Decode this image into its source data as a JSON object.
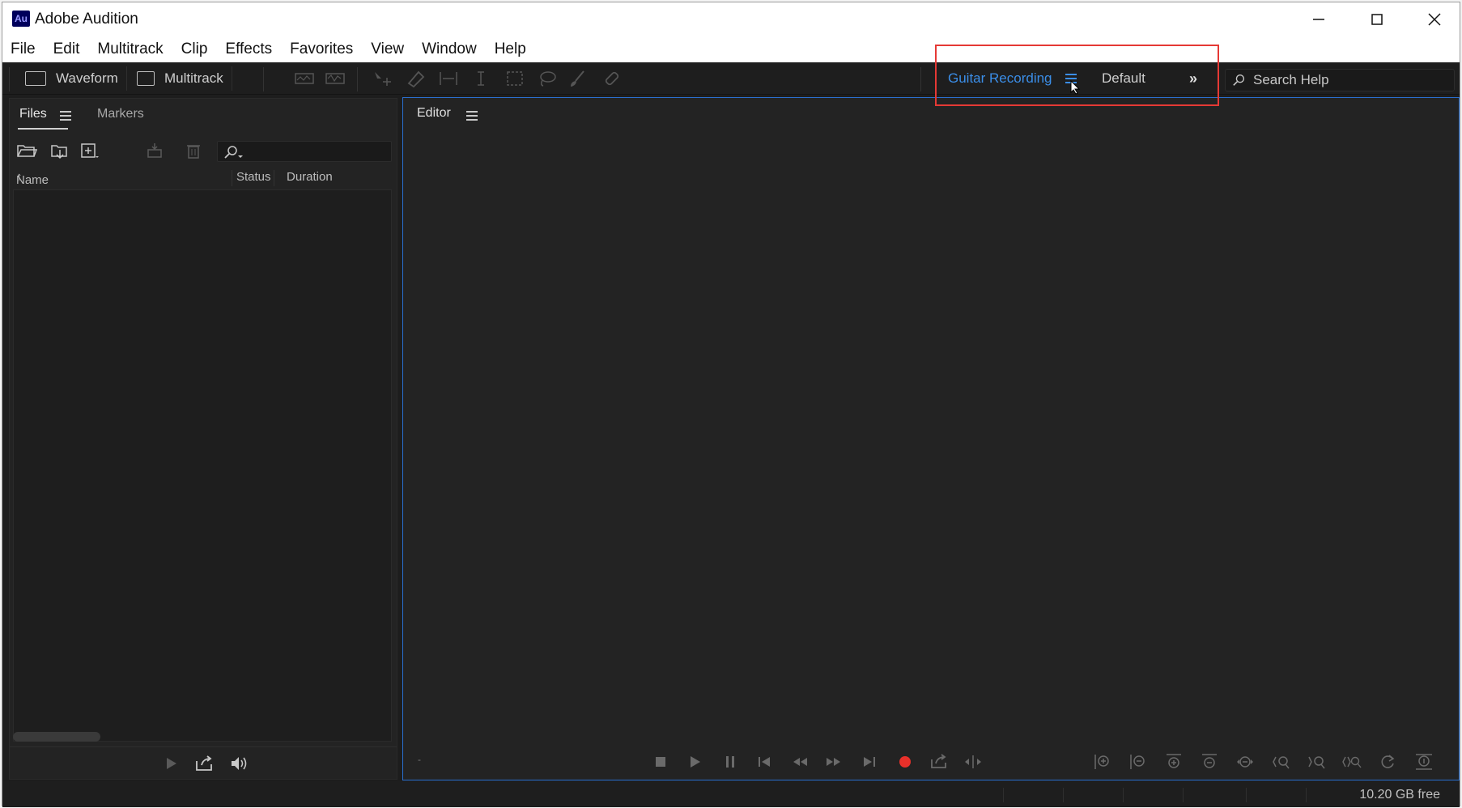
{
  "app": {
    "title": "Adobe Audition",
    "logo": "Au"
  },
  "menu": [
    "File",
    "Edit",
    "Multitrack",
    "Clip",
    "Effects",
    "Favorites",
    "View",
    "Window",
    "Help"
  ],
  "toolbar": {
    "waveform_label": "Waveform",
    "multitrack_label": "Multitrack",
    "workspace_active": "Guitar Recording",
    "workspace_default": "Default",
    "search_placeholder": "Search Help"
  },
  "files_panel": {
    "tab_files": "Files",
    "tab_markers": "Markers",
    "columns": {
      "name": "Name",
      "status": "Status",
      "duration": "Duration"
    }
  },
  "editor_panel": {
    "title": "Editor",
    "time": "-"
  },
  "status": {
    "free_space": "10.20 GB free"
  },
  "colors": {
    "accent": "#3b8ee8",
    "record": "#e8302a",
    "highlight": "#e53935",
    "panel_bg": "#232323"
  }
}
